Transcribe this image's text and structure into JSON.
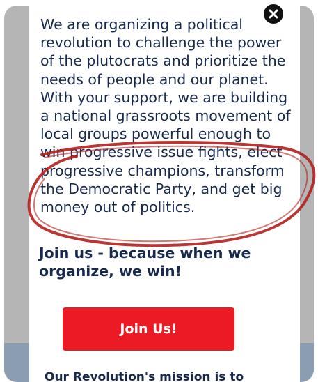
{
  "modal": {
    "body_text": "We are organizing a political revolution to challenge the power of the plutocrats and prioritize the needs of people and our planet. With your support, we are building a national grassroots movement of local groups powerful enough to win progressive issue fights, elect progressive champions, transform the Democratic Party, and get big money out of politics.",
    "join_line": "Join us - because when we organize, we win!",
    "join_button_label": "Join Us!",
    "footer_snippet": "Our Revolution's mission is to"
  },
  "icons": {
    "close": "close-icon"
  },
  "colors": {
    "text": "#17294d",
    "button": "#ec1a24",
    "annotation": "#b3201d",
    "backdrop": "#b5b5b5"
  }
}
